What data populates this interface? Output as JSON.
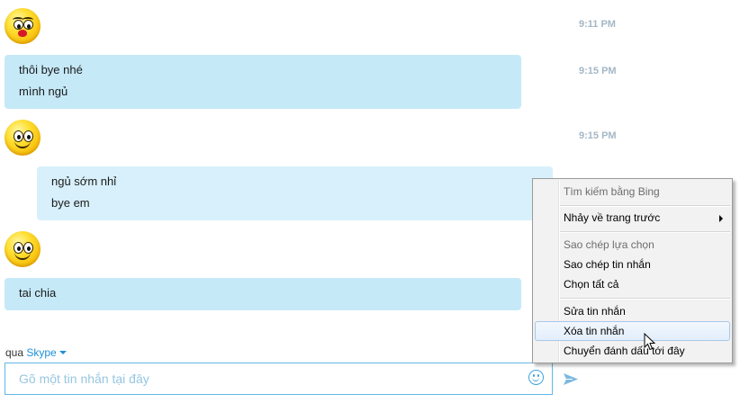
{
  "messages": [
    {
      "type": "emoticon",
      "emoticon": "kiss-face",
      "time": "9:11 PM"
    },
    {
      "type": "text",
      "lines": [
        "thôi bye nhé",
        "mình ngủ"
      ],
      "time": "9:15 PM"
    },
    {
      "type": "emoticon",
      "emoticon": "smile-face",
      "time": "9:15 PM"
    },
    {
      "type": "text",
      "lines": [
        "ngủ sớm nhỉ",
        "bye em"
      ]
    },
    {
      "type": "emoticon",
      "emoticon": "smile-face"
    },
    {
      "type": "text",
      "lines": [
        "tai chia"
      ]
    }
  ],
  "composer": {
    "via_prefix": "qua",
    "via_service": "Skype",
    "placeholder": "Gõ một tin nhắn tại đây",
    "emoticon_icon": "smiley-icon",
    "send_icon": "send-icon"
  },
  "context_menu": {
    "items": [
      {
        "label": "Tìm kiếm bằng Bing",
        "enabled": false
      },
      {
        "label": "Nhảy về trang trước",
        "enabled": true,
        "submenu": true
      },
      {
        "label": "Sao chép lựa chọn",
        "enabled": false
      },
      {
        "label": "Sao chép tin nhắn",
        "enabled": true
      },
      {
        "label": "Chọn tất cả",
        "enabled": true
      },
      {
        "label": "Sửa tin nhắn",
        "enabled": true
      },
      {
        "label": "Xóa tin nhắn",
        "enabled": true,
        "highlighted": true
      },
      {
        "label": "Chuyển đánh dấu tới đây",
        "enabled": true
      }
    ]
  },
  "colors": {
    "bubble": "#c6e9f8",
    "timestamp": "#a4b7c6",
    "accent": "#1e90d5"
  }
}
